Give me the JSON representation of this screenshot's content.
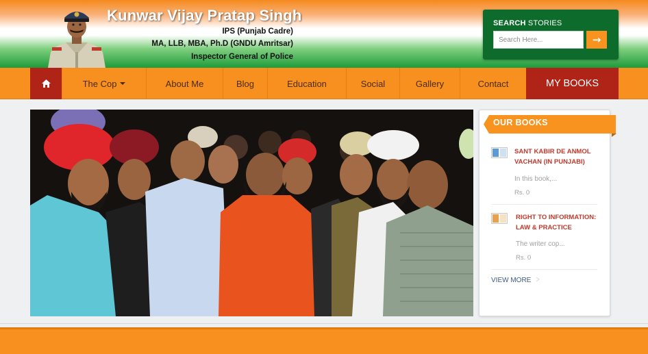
{
  "colors": {
    "saffron": "#f7901e",
    "green": "#0d6b2b",
    "maroon": "#b02418",
    "book_title_red": "#c0392b",
    "link_blue": "#3d5a87"
  },
  "header": {
    "name": "Kunwar Vijay Pratap Singh",
    "credential_1": "IPS (Punjab Cadre)",
    "credential_2": "MA, LLB, MBA, Ph.D (GNDU Amritsar)",
    "credential_3": "Inspector General of Police",
    "portrait_icon": "officer-portrait"
  },
  "search": {
    "title_bold": "SEARCH",
    "title_rest": " STORIES",
    "placeholder": "Search Here...",
    "button_icon": "arrow-right-icon",
    "button_glyph": "→"
  },
  "nav": {
    "home_icon": "home-icon",
    "items": [
      {
        "label": "The Cop"
      },
      {
        "label": "About Me"
      },
      {
        "label": "Blog"
      },
      {
        "label": "Education"
      },
      {
        "label": "Social"
      },
      {
        "label": "Gallery"
      },
      {
        "label": "Contact"
      }
    ],
    "books_label": "MY BOOKS"
  },
  "hero": {
    "image": "group-photo"
  },
  "sidebar": {
    "title": "OUR BOOKS",
    "books": [
      {
        "title_line1": "SANT KABIR DE ANMOL",
        "title_line2": "VACHAN (IN PUNJABI)",
        "description": "In this book,...",
        "price": "Rs. 0"
      },
      {
        "title_line1": "RIGHT TO INFORMATION:",
        "title_line2": "LAW & PRACTICE",
        "description": "The writer cop...",
        "price": "Rs. 0"
      }
    ],
    "view_more": "VIEW MORE",
    "view_more_icon": "chevron-right-icon"
  }
}
